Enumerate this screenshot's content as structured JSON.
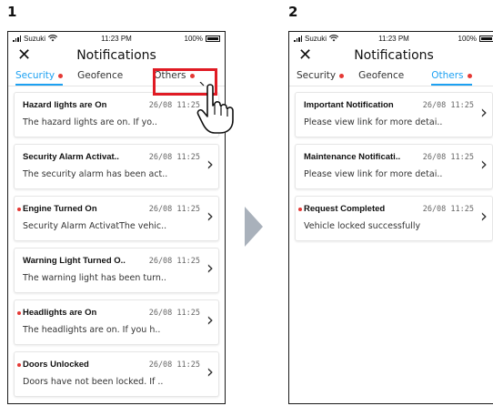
{
  "steps": [
    "1",
    "2"
  ],
  "status": {
    "carrier": "Suzuki",
    "time": "11:23 PM",
    "battery": "100%"
  },
  "header": {
    "title": "Notifications"
  },
  "tabs": {
    "security": "Security",
    "geofence": "Geofence",
    "others": "Others"
  },
  "colors": {
    "accent": "#1da1f2",
    "alert": "#e53935",
    "highlight": "#e01b24"
  },
  "icons": [
    "close-icon",
    "chevron-right-icon",
    "hand-pointer-icon",
    "arrow-right-icon",
    "wifi-icon",
    "signal-icon",
    "battery-icon"
  ],
  "screen1": {
    "active_tab": "security",
    "items": [
      {
        "title": "Hazard lights are On",
        "date": "26/08 11:25",
        "body": "The hazard lights are on. If yo..",
        "unread": false
      },
      {
        "title": "Security Alarm Activat..",
        "date": "26/08 11:25",
        "body": "The security alarm has been act..",
        "unread": false
      },
      {
        "title": "Engine Turned On",
        "date": "26/08 11:25",
        "body": "Security Alarm ActivatThe vehic..",
        "unread": true
      },
      {
        "title": "Warning Light Turned O..",
        "date": "26/08 11:25",
        "body": "The warning light has been turn..",
        "unread": false
      },
      {
        "title": "Headlights are On",
        "date": "26/08 11:25",
        "body": "The headlights are on. If you h..",
        "unread": true
      },
      {
        "title": "Doors Unlocked",
        "date": "26/08 11:25",
        "body": "Doors have not been locked. If ..",
        "unread": true
      }
    ]
  },
  "screen2": {
    "active_tab": "others",
    "items": [
      {
        "title": "Important Notification",
        "date": "26/08 11:25",
        "body": "Please view link for more detai..",
        "unread": false
      },
      {
        "title": "Maintenance Notificati..",
        "date": "26/08 11:25",
        "body": "Please view link for more detai..",
        "unread": false
      },
      {
        "title": "Request Completed",
        "date": "26/08 11:25",
        "body": "Vehicle locked successfully",
        "unread": true
      }
    ]
  }
}
